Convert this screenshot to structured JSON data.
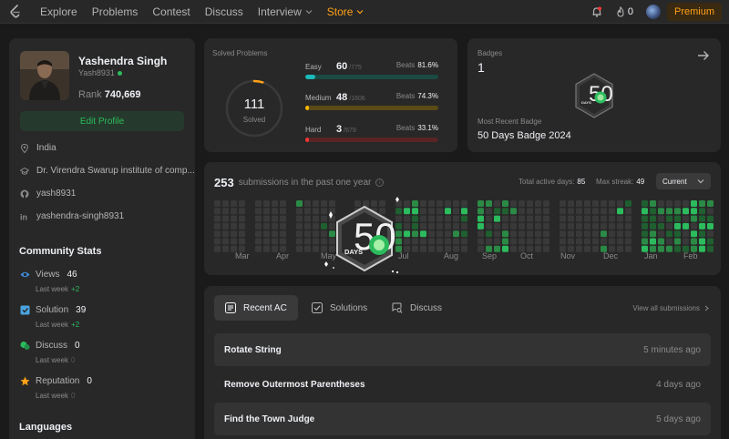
{
  "nav": {
    "items": [
      {
        "label": "Explore"
      },
      {
        "label": "Problems"
      },
      {
        "label": "Contest"
      },
      {
        "label": "Discuss"
      },
      {
        "label": "Interview",
        "dropdown": true
      },
      {
        "label": "Store",
        "dropdown": true
      }
    ],
    "streak_count": "0",
    "premium_label": "Premium"
  },
  "profile": {
    "name": "Yashendra Singh",
    "username": "Yash8931",
    "rank_label": "Rank",
    "rank_value": "740,669",
    "edit_label": "Edit Profile",
    "location": "India",
    "school": "Dr. Virendra Swarup institute of comp...",
    "github": "yash8931",
    "linkedin": "yashendra-singh8931"
  },
  "community": {
    "title": "Community Stats",
    "stats": [
      {
        "label": "Views",
        "value": "46",
        "sub": "Last week",
        "delta": "+2",
        "color": "#3d8bd8"
      },
      {
        "label": "Solution",
        "value": "39",
        "sub": "Last week",
        "delta": "+2",
        "color": "#4aa3df"
      },
      {
        "label": "Discuss",
        "value": "0",
        "sub": "Last week",
        "delta": "0",
        "color": "#2cbb5d"
      },
      {
        "label": "Reputation",
        "value": "0",
        "sub": "Last week",
        "delta": "0",
        "color": "#ffa116"
      }
    ],
    "languages_title": "Languages"
  },
  "solved": {
    "title": "Solved Problems",
    "total": "111",
    "total_label": "Solved",
    "difficulties": [
      {
        "name": "Easy",
        "count": "60",
        "total": "/775",
        "beats_label": "Beats",
        "beats": "81.6%",
        "fraction": 0.077,
        "color": "#1cbaba",
        "track": "#1a4a44"
      },
      {
        "name": "Medium",
        "count": "48",
        "total": "/1606",
        "beats_label": "Beats",
        "beats": "74.3%",
        "fraction": 0.03,
        "color": "#ffb700",
        "track": "#5a4a15"
      },
      {
        "name": "Hard",
        "count": "3",
        "total": "/679",
        "beats_label": "Beats",
        "beats": "33.1%",
        "fraction": 0.0044,
        "color": "#f63737",
        "track": "#5a2424"
      }
    ]
  },
  "badges": {
    "title": "Badges",
    "count": "1",
    "recent_label": "Most Recent Badge",
    "recent_value": "50 Days Badge 2024",
    "badge_text": "DAYS",
    "badge_number": "50"
  },
  "submissions": {
    "count": "253",
    "label": "submissions in the past one year",
    "active_label": "Total active days:",
    "active_value": "85",
    "streak_label": "Max streak:",
    "streak_value": "49",
    "period": "Current",
    "months": [
      "Mar",
      "Apr",
      "May",
      "Jun",
      "Jul",
      "Aug",
      "Sep",
      "Oct",
      "Nov",
      "Dec",
      "Jan",
      "Feb"
    ]
  },
  "recent": {
    "tabs": [
      {
        "label": "Recent AC",
        "active": true
      },
      {
        "label": "Solutions",
        "active": false
      },
      {
        "label": "Discuss",
        "active": false
      }
    ],
    "view_all": "View all submissions",
    "items": [
      {
        "title": "Rotate String",
        "time": "5 minutes ago"
      },
      {
        "title": "Remove Outermost Parentheses",
        "time": "4 days ago"
      },
      {
        "title": "Find the Town Judge",
        "time": "5 days ago"
      }
    ]
  }
}
